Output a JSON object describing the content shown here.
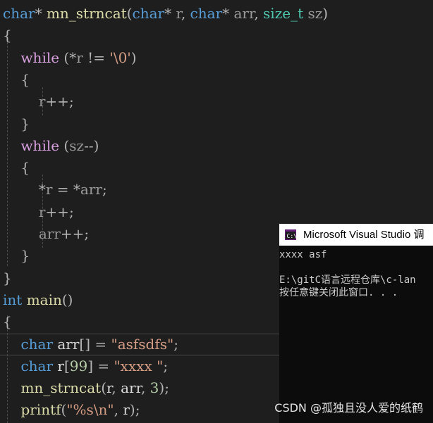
{
  "editor": {
    "lines": [
      {
        "tokens": [
          {
            "t": "char",
            "c": "kw"
          },
          {
            "t": "* ",
            "c": "pun"
          },
          {
            "t": "mn_strncat",
            "c": "fn"
          },
          {
            "t": "(",
            "c": "pun"
          },
          {
            "t": "char",
            "c": "kw"
          },
          {
            "t": "* ",
            "c": "pun"
          },
          {
            "t": "r",
            "c": "param"
          },
          {
            "t": ", ",
            "c": "pun"
          },
          {
            "t": "char",
            "c": "kw"
          },
          {
            "t": "* ",
            "c": "pun"
          },
          {
            "t": "arr",
            "c": "param"
          },
          {
            "t": ", ",
            "c": "pun"
          },
          {
            "t": "size_t",
            "c": "typ"
          },
          {
            "t": " ",
            "c": "pun"
          },
          {
            "t": "sz",
            "c": "param"
          },
          {
            "t": ")",
            "c": "pun"
          }
        ]
      },
      {
        "tokens": [
          {
            "t": "{",
            "c": "pun"
          }
        ]
      },
      {
        "tokens": [
          {
            "t": "    ",
            "c": "pun"
          },
          {
            "t": "while",
            "c": "ctl"
          },
          {
            "t": " (*",
            "c": "pun"
          },
          {
            "t": "r",
            "c": "param"
          },
          {
            "t": " != ",
            "c": "pun"
          },
          {
            "t": "'\\0'",
            "c": "str"
          },
          {
            "t": ")",
            "c": "pun"
          }
        ]
      },
      {
        "tokens": [
          {
            "t": "    {",
            "c": "pun"
          }
        ]
      },
      {
        "tokens": [
          {
            "t": "        ",
            "c": "pun"
          },
          {
            "t": "r",
            "c": "param"
          },
          {
            "t": "++;",
            "c": "pun"
          }
        ]
      },
      {
        "tokens": [
          {
            "t": "    }",
            "c": "pun"
          }
        ]
      },
      {
        "tokens": [
          {
            "t": "    ",
            "c": "pun"
          },
          {
            "t": "while",
            "c": "ctl"
          },
          {
            "t": " (",
            "c": "pun"
          },
          {
            "t": "sz",
            "c": "param"
          },
          {
            "t": "--)",
            "c": "pun"
          }
        ]
      },
      {
        "tokens": [
          {
            "t": "    {",
            "c": "pun"
          }
        ]
      },
      {
        "tokens": [
          {
            "t": "        *",
            "c": "pun"
          },
          {
            "t": "r",
            "c": "param"
          },
          {
            "t": " = *",
            "c": "pun"
          },
          {
            "t": "arr",
            "c": "param"
          },
          {
            "t": ";",
            "c": "pun"
          }
        ]
      },
      {
        "tokens": [
          {
            "t": "        ",
            "c": "pun"
          },
          {
            "t": "r",
            "c": "param"
          },
          {
            "t": "++;",
            "c": "pun"
          }
        ]
      },
      {
        "tokens": [
          {
            "t": "        ",
            "c": "pun"
          },
          {
            "t": "arr",
            "c": "param"
          },
          {
            "t": "++;",
            "c": "pun"
          }
        ]
      },
      {
        "tokens": [
          {
            "t": "    }",
            "c": "pun"
          }
        ]
      },
      {
        "tokens": [
          {
            "t": "}",
            "c": "pun"
          }
        ]
      },
      {
        "tokens": [
          {
            "t": "int",
            "c": "kw"
          },
          {
            "t": " ",
            "c": "pun"
          },
          {
            "t": "main",
            "c": "fn"
          },
          {
            "t": "()",
            "c": "pun"
          }
        ]
      },
      {
        "tokens": [
          {
            "t": "{",
            "c": "pun"
          }
        ]
      },
      {
        "tokens": [
          {
            "t": "    ",
            "c": "pun"
          },
          {
            "t": "char",
            "c": "kw"
          },
          {
            "t": " ",
            "c": "pun"
          },
          {
            "t": "arr",
            "c": "var"
          },
          {
            "t": "[] = ",
            "c": "pun"
          },
          {
            "t": "\"asfsdfs\"",
            "c": "str"
          },
          {
            "t": ";",
            "c": "pun"
          }
        ]
      },
      {
        "tokens": [
          {
            "t": "    ",
            "c": "pun"
          },
          {
            "t": "char",
            "c": "kw"
          },
          {
            "t": " ",
            "c": "pun"
          },
          {
            "t": "r",
            "c": "var"
          },
          {
            "t": "[",
            "c": "pun"
          },
          {
            "t": "99",
            "c": "num"
          },
          {
            "t": "] = ",
            "c": "pun"
          },
          {
            "t": "\"xxxx \"",
            "c": "str"
          },
          {
            "t": ";",
            "c": "pun"
          }
        ]
      },
      {
        "tokens": [
          {
            "t": "    ",
            "c": "pun"
          },
          {
            "t": "mn_strncat",
            "c": "fn"
          },
          {
            "t": "(",
            "c": "pun"
          },
          {
            "t": "r",
            "c": "var"
          },
          {
            "t": ", ",
            "c": "pun"
          },
          {
            "t": "arr",
            "c": "var"
          },
          {
            "t": ", ",
            "c": "pun"
          },
          {
            "t": "3",
            "c": "num"
          },
          {
            "t": ");",
            "c": "pun"
          }
        ]
      },
      {
        "tokens": [
          {
            "t": "    ",
            "c": "pun"
          },
          {
            "t": "printf",
            "c": "fn"
          },
          {
            "t": "(",
            "c": "pun"
          },
          {
            "t": "\"%s\\n\"",
            "c": "str"
          },
          {
            "t": ", ",
            "c": "pun"
          },
          {
            "t": "r",
            "c": "var"
          },
          {
            "t": ");",
            "c": "pun"
          }
        ]
      }
    ]
  },
  "console": {
    "title": "Microsoft Visual Studio 调",
    "icon": "visual-studio-console-icon",
    "output": [
      "xxxx asf",
      "",
      "E:\\gitC语言远程仓库\\c-lan",
      "按任意键关闭此窗口. . ."
    ]
  },
  "watermark": "CSDN @孤独且没人爱的纸鹤",
  "colors": {
    "editor_bg": "#1e1e1e",
    "keyword": "#569cd6",
    "control": "#d8a0df",
    "type": "#4ec9b0",
    "function": "#dcdcaa",
    "string": "#d69d85",
    "number": "#b5cea8",
    "console_bg": "#0c0c0c",
    "console_title_bg": "#ffffff"
  }
}
